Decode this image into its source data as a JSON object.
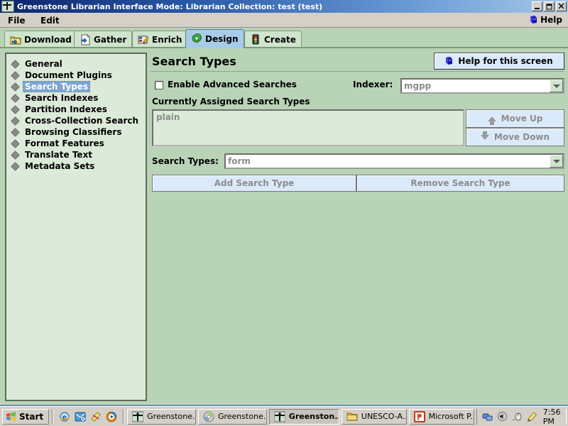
{
  "window": {
    "title": "Greenstone Librarian Interface  Mode: Librarian  Collection: test (test)",
    "icon": "greenstone-icon",
    "minimize_label": "_",
    "maximize_label": "❐",
    "close_label": "✕"
  },
  "menubar": {
    "file_label": "File",
    "edit_label": "Edit",
    "help_label": "Help",
    "help_icon": "help-book-icon"
  },
  "tabs": [
    {
      "label": "Download",
      "icon": "download-folder-icon",
      "active": false
    },
    {
      "label": "Gather",
      "icon": "gather-page-icon",
      "active": false
    },
    {
      "label": "Enrich",
      "icon": "enrich-pencil-icon",
      "active": false
    },
    {
      "label": "Design",
      "icon": "design-gear-icon",
      "active": true
    },
    {
      "label": "Create",
      "icon": "create-trafficlight-icon",
      "active": false
    }
  ],
  "sidebar": {
    "items": [
      {
        "label": "General",
        "selected": false
      },
      {
        "label": "Document Plugins",
        "selected": false
      },
      {
        "label": "Search Types",
        "selected": true
      },
      {
        "label": "Search Indexes",
        "selected": false
      },
      {
        "label": "Partition Indexes",
        "selected": false
      },
      {
        "label": "Cross-Collection Search",
        "selected": false
      },
      {
        "label": "Browsing Classifiers",
        "selected": false
      },
      {
        "label": "Format Features",
        "selected": false
      },
      {
        "label": "Translate Text",
        "selected": false
      },
      {
        "label": "Metadata Sets",
        "selected": false
      }
    ]
  },
  "main": {
    "panel_title": "Search Types",
    "help_button": {
      "label": "Help for this screen",
      "icon": "help-book-icon"
    },
    "advanced_searches": {
      "label": "Enable Advanced Searches",
      "checked": false
    },
    "indexer": {
      "label": "Indexer:",
      "value": "mgpp",
      "enabled": false
    },
    "assigned": {
      "label": "Currently Assigned Search Types",
      "items": [
        "plain"
      ]
    },
    "move_up": {
      "label": "Move Up",
      "icon": "arrow-up-icon",
      "enabled": false
    },
    "move_down": {
      "label": "Move Down",
      "icon": "arrow-down-icon",
      "enabled": false
    },
    "search_types": {
      "label": "Search Types:",
      "value": "form",
      "enabled": false
    },
    "add_button": {
      "label": "Add Search Type",
      "enabled": false
    },
    "remove_button": {
      "label": "Remove Search Type",
      "enabled": false
    }
  },
  "taskbar": {
    "start_label": "Start",
    "start_icon": "windows-flag-icon",
    "quick_launch": [
      {
        "icon": "internet-explorer-icon"
      },
      {
        "icon": "outlook-express-icon"
      },
      {
        "icon": "show-desktop-icon"
      },
      {
        "icon": "media-player-icon"
      }
    ],
    "tasks": [
      {
        "label": "Greenstone...",
        "icon": "greenstone-icon",
        "active": false
      },
      {
        "label": "Greenstone...",
        "icon": "cd-disc-icon",
        "active": false
      },
      {
        "label": "Greenston...",
        "icon": "greenstone-icon",
        "active": true
      },
      {
        "label": "UNESCO-A...",
        "icon": "folder-icon",
        "active": false
      },
      {
        "label": "Microsoft P...",
        "icon": "powerpoint-icon",
        "active": false
      }
    ],
    "tray_icons": [
      {
        "icon": "network-icon"
      },
      {
        "icon": "volume-icon"
      },
      {
        "icon": "mouse-icon"
      },
      {
        "icon": "pencil-icon"
      }
    ],
    "clock": "7:56 PM"
  },
  "colors": {
    "app_background": "#b9d3b6",
    "sidebar_background": "#dcead9",
    "selection_blue": "#7aa6d6",
    "button_blue": "#dbeafb",
    "active_tab_blue": "#a8cbe8",
    "titlebar_dark": "#0a246a",
    "disabled_text": "#8c8c8c",
    "taskbar_gray": "#d4d0c8"
  }
}
